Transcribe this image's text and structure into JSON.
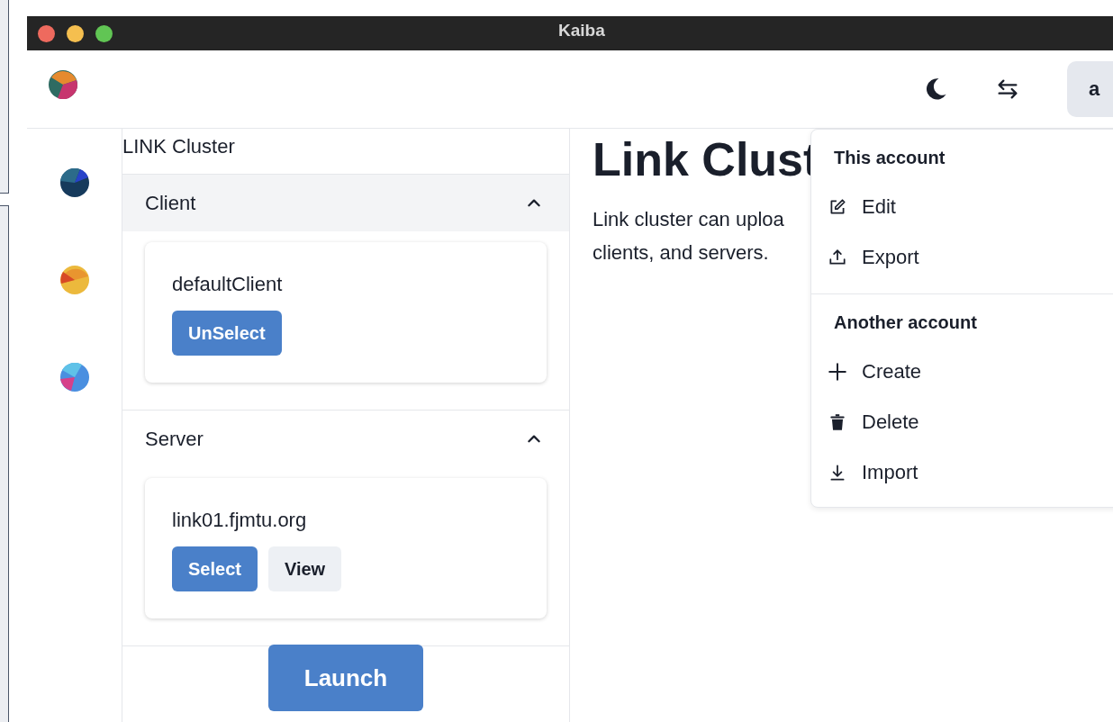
{
  "window": {
    "title": "Kaiba"
  },
  "header": {
    "avatar": "a"
  },
  "panel": {
    "title": "LINK Cluster",
    "sections": [
      {
        "title": "Client",
        "expanded": true,
        "highlighted": true,
        "items": [
          {
            "name": "defaultClient",
            "buttons": [
              {
                "label": "UnSelect",
                "kind": "primary"
              }
            ]
          }
        ]
      },
      {
        "title": "Server",
        "expanded": true,
        "highlighted": false,
        "items": [
          {
            "name": "link01.fjmtu.org",
            "buttons": [
              {
                "label": "Select",
                "kind": "primary"
              },
              {
                "label": "View",
                "kind": "secondary"
              }
            ]
          }
        ]
      }
    ],
    "launch": "Launch"
  },
  "main": {
    "heading": "Link Clust",
    "lines": [
      "Link cluster can uploa",
      "clients, and servers."
    ]
  },
  "menu": {
    "groups": [
      {
        "title": "This account",
        "items": [
          {
            "label": "Edit",
            "kind": "edit"
          },
          {
            "label": "Export",
            "kind": "export"
          }
        ]
      },
      {
        "title": "Another account",
        "items": [
          {
            "label": "Create",
            "kind": "create"
          },
          {
            "label": "Delete",
            "kind": "delete"
          },
          {
            "label": "Import",
            "kind": "import"
          }
        ]
      }
    ]
  }
}
